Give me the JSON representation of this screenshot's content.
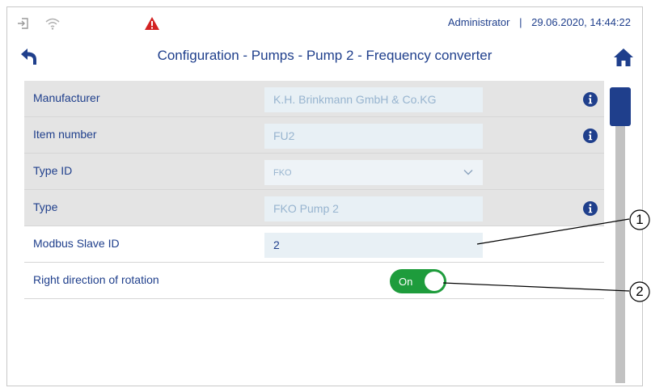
{
  "status_bar": {
    "user": "Administrator",
    "datetime": "29.06.2020, 14:44:22",
    "icons": [
      "login-icon",
      "wifi-icon",
      "warning-icon"
    ],
    "warning_color": "#d32222"
  },
  "header": {
    "title": "Configuration - Pumps - Pump 2 - Frequency converter",
    "back_icon": "back-arrow-icon",
    "home_icon": "home-icon"
  },
  "rows": [
    {
      "label": "Manufacturer",
      "value": "K.H. Brinkmann GmbH & Co.KG",
      "editable": false,
      "info": true
    },
    {
      "label": "Item number",
      "value": "FU2",
      "editable": false,
      "info": true
    },
    {
      "label": "Type ID",
      "value": "FKO",
      "editable": true,
      "type": "select"
    },
    {
      "label": "Type",
      "value": "FKO Pump 2",
      "editable": false,
      "info": true
    },
    {
      "label": "Modbus Slave ID",
      "value": "2",
      "editable": true
    },
    {
      "label": "Right direction of rotation",
      "toggle_label": "On",
      "toggle_on": true,
      "editable": true
    }
  ],
  "callouts": [
    "1",
    "2"
  ],
  "colors": {
    "accent": "#1f3f8c",
    "toggle_on": "#1e9c3c",
    "readonly_row": "#e4e4e4",
    "field_bg": "#e8f0f5"
  }
}
